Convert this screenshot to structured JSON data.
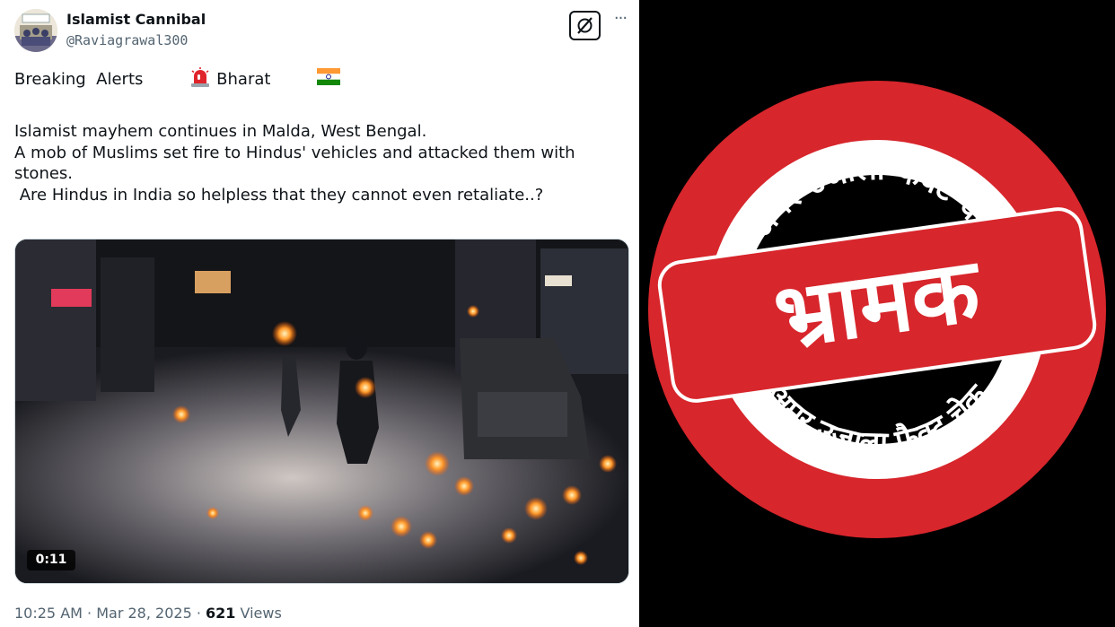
{
  "tweet": {
    "author": {
      "display_name": "Islamist Cannibal",
      "handle": "@Raviagrawal300"
    },
    "text": {
      "headline_part1": "Breaking  Alerts",
      "headline_part2": "Bharat",
      "line1": "Islamist mayhem continues in Malda, West Bengal.",
      "line2": "A mob of Muslims set fire to Hindus' vehicles and attacked them with",
      "line3": "stones.",
      "line4": " Are Hindus in India so helpless that they cannot even retaliate..?"
    },
    "video": {
      "duration": "0:11"
    },
    "meta": {
      "time": "10:25 AM",
      "separator": " · ",
      "date": "Mar 28, 2025",
      "views_count": "621",
      "views_label": "Views"
    },
    "icons": {
      "alert": "police-light-emoji-icon",
      "flag": "india-flag-emoji-icon",
      "grok": "grok-icon",
      "more": "more-options-icon"
    }
  },
  "stamp": {
    "verdict": "भ्रामक",
    "ring_text_top": "अमर उजाला फैक्ट चेक",
    "ring_text_bottom": "अमर उजाला फैक्ट चेक",
    "colors": {
      "ring": "#ffffff",
      "banner": "#d7262c",
      "background": "#000000"
    }
  }
}
